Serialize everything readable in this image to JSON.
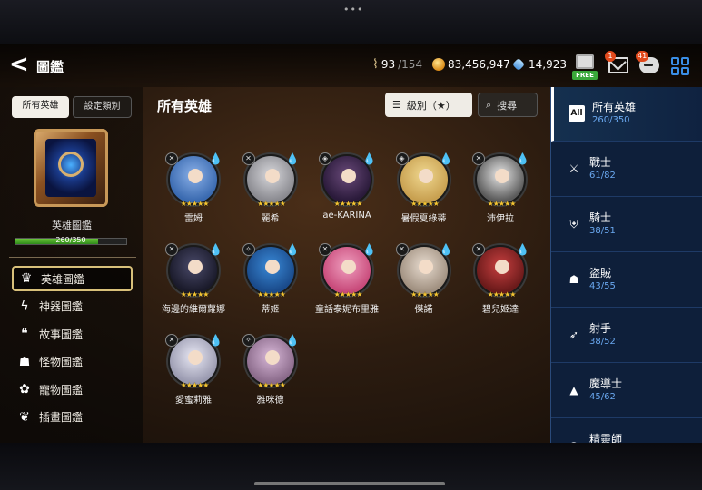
{
  "header": {
    "title": "圖鑑",
    "stamina": "93",
    "stamina_max": "/154",
    "gold": "83,456,947",
    "gems": "14,923",
    "shop_label": "FREE",
    "mail_badge": "1",
    "chat_badge": "41"
  },
  "left": {
    "tab_all": "所有英雄",
    "tab_category": "設定類別",
    "book_title": "英雄圖鑑",
    "progress_text": "260/350",
    "progress_fraction": 0.743,
    "menu": [
      {
        "label": "英雄圖鑑",
        "icon": "hero-book-icon"
      },
      {
        "label": "神器圖鑑",
        "icon": "lightning-icon"
      },
      {
        "label": "故事圖鑑",
        "icon": "speech-icon"
      },
      {
        "label": "怪物圖鑑",
        "icon": "monster-icon"
      },
      {
        "label": "寵物圖鑑",
        "icon": "paw-icon"
      },
      {
        "label": "插畫圖鑑",
        "icon": "dragon-icon"
      }
    ]
  },
  "grid": {
    "title": "所有英雄",
    "sort_label": "級別（★）",
    "search_label": "搜尋",
    "heroes": [
      {
        "name": "雷姆",
        "stars": "★★★★★",
        "colors": [
          "#3a6ab0",
          "#8ab0e8"
        ]
      },
      {
        "name": "麗希",
        "stars": "★★★★★",
        "colors": [
          "#8a8a90",
          "#d8d8dc"
        ]
      },
      {
        "name": "ae-KARINA",
        "stars": "★★★★★",
        "colors": [
          "#2a1a3a",
          "#6a4a7a"
        ]
      },
      {
        "name": "暑假夏綠蒂",
        "stars": "★★★★★",
        "colors": [
          "#c8a050",
          "#f0d890"
        ]
      },
      {
        "name": "沛伊拉",
        "stars": "★★★★★",
        "colors": [
          "#5a5a5a",
          "#e8e8e8"
        ]
      },
      {
        "name": "海邊的維爾蘿娜",
        "stars": "★★★★★",
        "colors": [
          "#1a1a2a",
          "#4a4a6a"
        ]
      },
      {
        "name": "蒂姬",
        "stars": "★★★★★",
        "colors": [
          "#1a4a8a",
          "#3a8ad8"
        ]
      },
      {
        "name": "童話泰妮布里雅",
        "stars": "★★★★★",
        "colors": [
          "#c84a7a",
          "#f0a0c0"
        ]
      },
      {
        "name": "傑諾",
        "stars": "★★★★★",
        "colors": [
          "#a09080",
          "#e8dcd0"
        ]
      },
      {
        "name": "碧兒姬達",
        "stars": "★★★★★",
        "colors": [
          "#6a1a1a",
          "#c84040"
        ]
      },
      {
        "name": "愛蜜莉雅",
        "stars": "★★★★★",
        "colors": [
          "#9a9ab0",
          "#e8e8f4"
        ]
      },
      {
        "name": "雅咪德",
        "stars": "★★★★★",
        "colors": [
          "#8a6a8a",
          "#d8b8d8"
        ]
      }
    ]
  },
  "categories": [
    {
      "name": "所有英雄",
      "count": "260/350",
      "icon": "All"
    },
    {
      "name": "戰士",
      "count": "61/82",
      "icon": "sword-icon"
    },
    {
      "name": "騎士",
      "count": "38/51",
      "icon": "shield-icon"
    },
    {
      "name": "盜賊",
      "count": "43/55",
      "icon": "hood-icon"
    },
    {
      "name": "射手",
      "count": "38/52",
      "icon": "bow-icon"
    },
    {
      "name": "魔導士",
      "count": "45/62",
      "icon": "wizard-hat-icon"
    },
    {
      "name": "精靈師",
      "count": "",
      "icon": "spirit-icon"
    }
  ]
}
